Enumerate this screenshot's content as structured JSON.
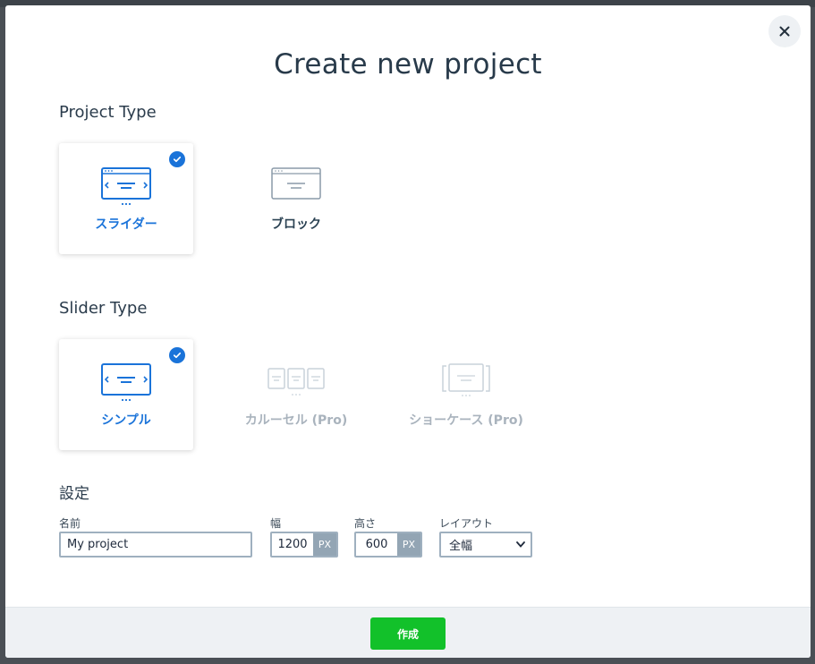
{
  "modal": {
    "title": "Create new project",
    "close_icon": "close-icon"
  },
  "project_type": {
    "heading": "Project Type",
    "options": [
      {
        "label": "スライダー",
        "icon": "slider-icon",
        "selected": true
      },
      {
        "label": "ブロック",
        "icon": "block-icon",
        "selected": false
      }
    ]
  },
  "slider_type": {
    "heading": "Slider Type",
    "options": [
      {
        "label": "シンプル",
        "icon": "simple-slider-icon",
        "selected": true,
        "disabled": false
      },
      {
        "label": "カルーセル (Pro)",
        "icon": "carousel-icon",
        "selected": false,
        "disabled": true
      },
      {
        "label": "ショーケース (Pro)",
        "icon": "showcase-icon",
        "selected": false,
        "disabled": true
      }
    ]
  },
  "settings": {
    "heading": "設定",
    "name": {
      "label": "名前",
      "value": "My project"
    },
    "width": {
      "label": "幅",
      "value": "1200",
      "unit": "PX"
    },
    "height": {
      "label": "高さ",
      "value": "600",
      "unit": "PX"
    },
    "layout": {
      "label": "レイアウト",
      "value": "全幅"
    }
  },
  "footer": {
    "create_label": "作成"
  },
  "colors": {
    "accent": "#1a73d9",
    "create_button": "#12c12a",
    "disabled": "#a9b3bd"
  }
}
